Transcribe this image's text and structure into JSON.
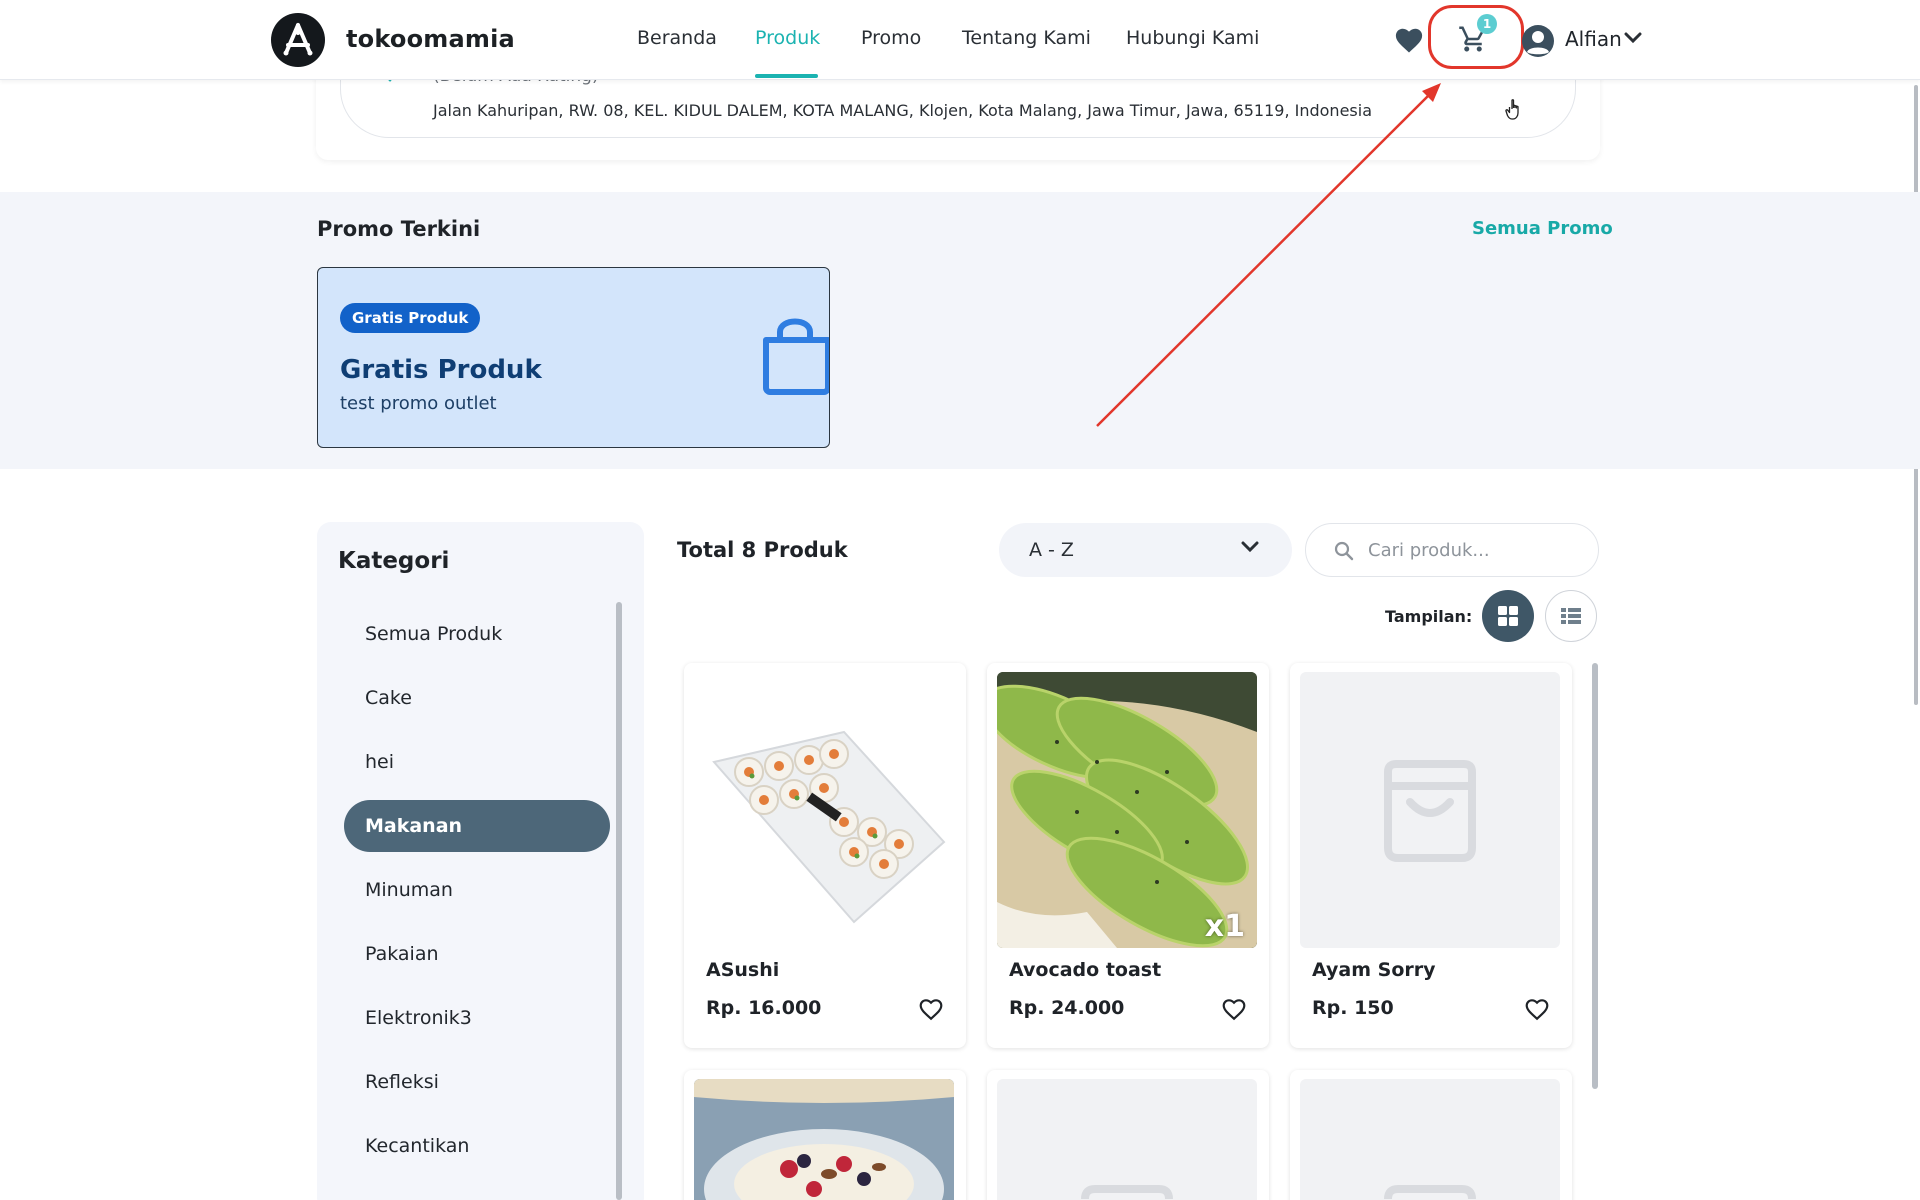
{
  "header": {
    "brand": "tokoomamia",
    "nav": [
      "Beranda",
      "Produk",
      "Promo",
      "Tentang Kami",
      "Hubungi Kami"
    ],
    "active_nav": "Produk",
    "cart_count": "1",
    "user_name": "Alfian"
  },
  "address": {
    "rating_text": "(Belum Ada Rating)",
    "full_address": "Jalan Kahuripan, RW. 08, KEL. KIDUL DALEM, KOTA MALANG, Klojen, Kota Malang, Jawa Timur, Jawa, 65119, Indonesia"
  },
  "promo": {
    "section_title": "Promo Terkini",
    "see_all": "Semua Promo",
    "cards": [
      {
        "tag": "Gratis Produk",
        "title": "Gratis Produk",
        "description": "test promo outlet"
      }
    ]
  },
  "categories": {
    "title": "Kategori",
    "items": [
      "Semua Produk",
      "Cake",
      "hei",
      "Makanan",
      "Minuman",
      "Pakaian",
      "Elektronik3",
      "Refleksi",
      "Kecantikan"
    ],
    "active": "Makanan"
  },
  "products_toolbar": {
    "total_label": "Total 8 Produk",
    "sort_value": "A - Z",
    "search_placeholder": "Cari produk...",
    "view_label": "Tampilan:",
    "view_mode": "grid"
  },
  "products": [
    {
      "name": "ASushi",
      "price": "Rp. 16.000",
      "image": "sushi",
      "qty_in_cart": ""
    },
    {
      "name": "Avocado toast",
      "price": "Rp. 24.000",
      "image": "avocado-toast",
      "qty_in_cart": "x1"
    },
    {
      "name": "Ayam Sorry",
      "price": "Rp. 150",
      "image": "placeholder",
      "qty_in_cart": ""
    }
  ],
  "colors": {
    "accent": "#1bb3b1",
    "active_category": "#4d6779",
    "promo_card_bg": "#d3e5fb",
    "promo_tag": "#1262c9",
    "annotation": "#e2362b"
  }
}
